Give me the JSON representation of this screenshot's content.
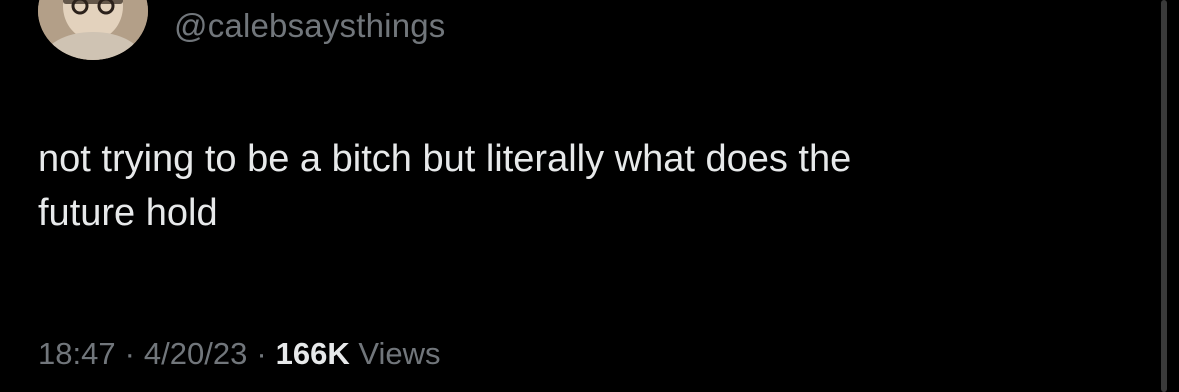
{
  "tweet": {
    "handle": "@calebsaysthings",
    "text_lines": [
      "not trying to be a bitch but literally what does the",
      "future hold"
    ],
    "time": "18:47",
    "separator": "·",
    "date": "4/20/23",
    "views_count": "166K",
    "views_label": "Views"
  },
  "colors": {
    "background": "#000000",
    "primary_text": "#e7e9ea",
    "secondary_text": "#71767b"
  }
}
